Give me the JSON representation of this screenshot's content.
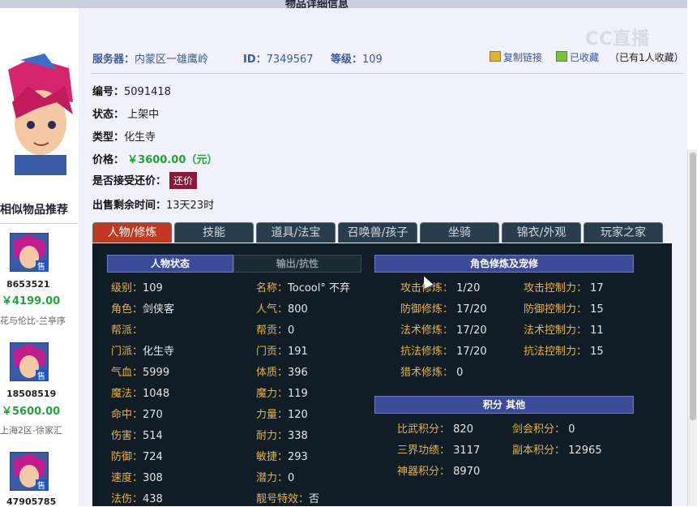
{
  "header": {
    "title": "物品详细信息"
  },
  "watermark": "CC直播",
  "info": {
    "server_label": "服务器：",
    "server_value": "内蒙区一雄鹰岭",
    "id_label": "ID：",
    "id_value": "7349567",
    "level_label": "等级：",
    "level_value": "109",
    "copy_link": "复制链接",
    "favorited": "已收藏",
    "fav_count": "（已有1人收藏）"
  },
  "details": {
    "serial_label": "编号：",
    "serial_value": "5091418",
    "status_label": "状态：",
    "status_value": "上架中",
    "type_label": "类型：",
    "type_value": "化生寺",
    "price_label": "价格：",
    "price_value": "￥3600.00（元）",
    "haggle_label": "是否接受还价：",
    "haggle_button": "还价",
    "remaining_label": "出售剩余时间：",
    "remaining_value": "13天23时"
  },
  "similar": {
    "title": "相似物品推荐",
    "items": [
      {
        "id": "8653521",
        "price": "￥4199.00",
        "server": "花与伦比-兰亭序"
      },
      {
        "id": "18508519",
        "price": "￥5600.00",
        "server": "上海2区-徐家汇"
      },
      {
        "id": "47905785"
      }
    ],
    "sale_badge": "售"
  },
  "tabs": [
    "人物/修炼",
    "技能",
    "道具/法宝",
    "召唤兽/孩子",
    "坐骑",
    "锦衣/外观",
    "玩家之家"
  ],
  "panel": {
    "left_tab_active": "人物状态",
    "left_tab_inactive": "输出/抗性",
    "right_head": "角色修炼及宠修",
    "score_head": "积分 其他",
    "stats_col1": [
      {
        "k": "级别：",
        "v": "109"
      },
      {
        "k": "角色：",
        "v": "剑侠客"
      },
      {
        "k": "帮派：",
        "v": ""
      },
      {
        "k": "门派：",
        "v": "化生寺"
      },
      {
        "k": "气血：",
        "v": "5999"
      },
      {
        "k": "魔法：",
        "v": "1048"
      },
      {
        "k": "命中：",
        "v": "270"
      },
      {
        "k": "伤害：",
        "v": "514"
      },
      {
        "k": "防御：",
        "v": "724"
      },
      {
        "k": "速度：",
        "v": "308"
      },
      {
        "k": "法伤：",
        "v": "438"
      }
    ],
    "stats_col2": [
      {
        "k": "名称：",
        "v": "Tocool° 不弃"
      },
      {
        "k": "人气：",
        "v": "800"
      },
      {
        "k": "帮贡：",
        "v": "0"
      },
      {
        "k": "门贡：",
        "v": "191"
      },
      {
        "k": "体质：",
        "v": "396"
      },
      {
        "k": "魔力：",
        "v": "119"
      },
      {
        "k": "力量：",
        "v": "120"
      },
      {
        "k": "耐力：",
        "v": "338"
      },
      {
        "k": "敏捷：",
        "v": "293"
      },
      {
        "k": "潜力：",
        "v": "0"
      },
      {
        "k": "靓号特效：",
        "v": "否"
      }
    ],
    "cultivation_col1": [
      {
        "k": "攻击修炼：",
        "v": "1/20"
      },
      {
        "k": "防御修炼：",
        "v": "17/20"
      },
      {
        "k": "法术修炼：",
        "v": "17/20"
      },
      {
        "k": "抗法修炼：",
        "v": "17/20"
      },
      {
        "k": "猎术修炼：",
        "v": "0"
      }
    ],
    "cultivation_col2": [
      {
        "k": "攻击控制力：",
        "v": "17"
      },
      {
        "k": "防御控制力：",
        "v": "15"
      },
      {
        "k": "法术控制力：",
        "v": "11"
      },
      {
        "k": "抗法控制力：",
        "v": "15"
      }
    ],
    "scores_col1": [
      {
        "k": "比武积分：",
        "v": "820"
      },
      {
        "k": "三界功绩：",
        "v": "3117"
      },
      {
        "k": "神器积分：",
        "v": "8970"
      }
    ],
    "scores_col2": [
      {
        "k": "剑会积分：",
        "v": "0"
      },
      {
        "k": "副本积分：",
        "v": "12965"
      }
    ]
  },
  "colors": {
    "accent_red": "#c0391f",
    "price_green": "#22a33a",
    "label_gold": "#e9b43e",
    "panel_bg": "#101d26"
  }
}
